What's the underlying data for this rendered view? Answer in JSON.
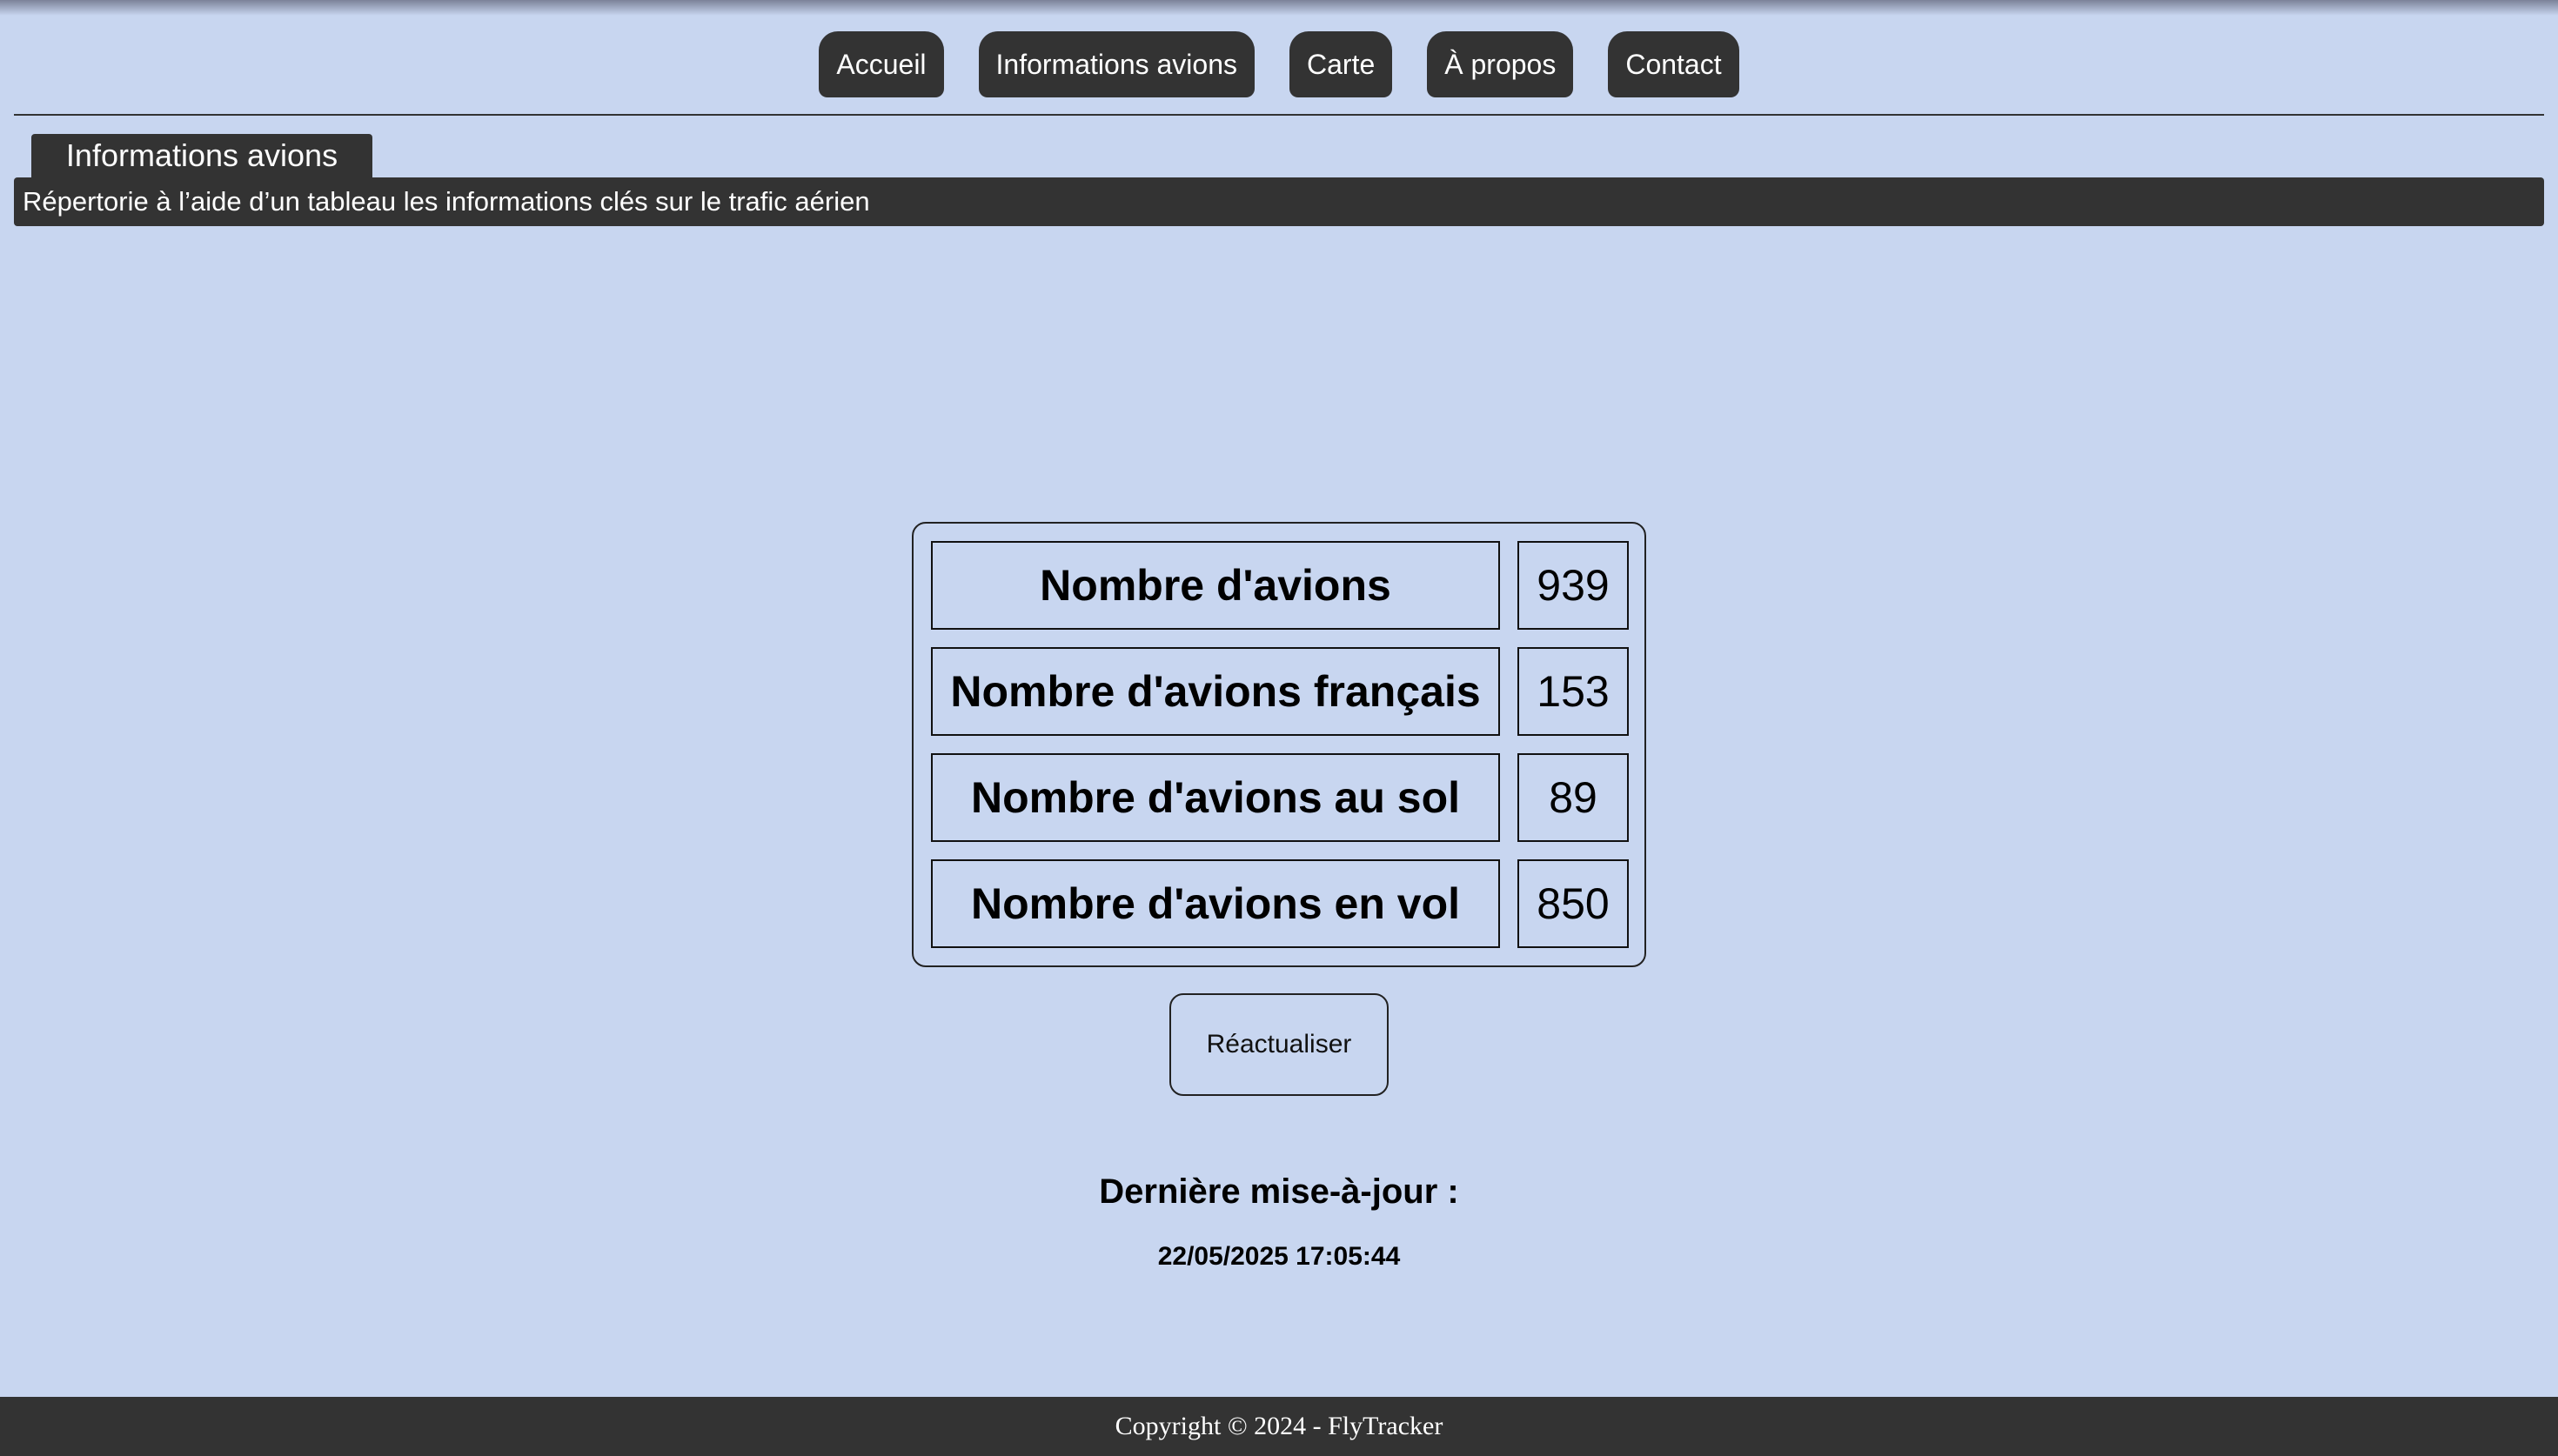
{
  "nav": {
    "items": [
      {
        "label": "Accueil"
      },
      {
        "label": "Informations avions"
      },
      {
        "label": "Carte"
      },
      {
        "label": "À propos"
      },
      {
        "label": "Contact"
      }
    ]
  },
  "section": {
    "title": "Informations avions",
    "description": "Répertorie à l’aide d’un tableau les informations clés sur le trafic aérien"
  },
  "stats": {
    "rows": [
      {
        "label": "Nombre d'avions",
        "value": "939"
      },
      {
        "label": "Nombre d'avions français",
        "value": "153"
      },
      {
        "label": "Nombre d'avions au sol",
        "value": "89"
      },
      {
        "label": "Nombre d'avions en vol",
        "value": "850"
      }
    ]
  },
  "refresh": {
    "label": "Réactualiser"
  },
  "update": {
    "title": "Dernière mise-à-jour :",
    "timestamp": "22/05/2025 17:05:44"
  },
  "footer": {
    "text": "Copyright © 2024 - FlyTracker"
  },
  "colors": {
    "background": "#c8d6f0",
    "dark": "#333333",
    "text_light": "#ffffff"
  }
}
